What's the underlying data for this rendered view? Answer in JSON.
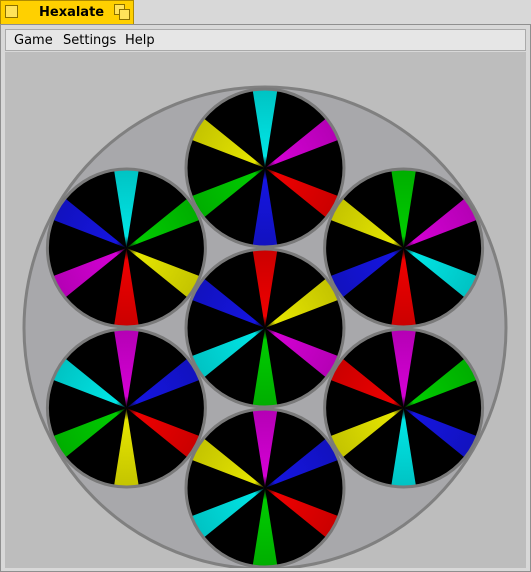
{
  "window": {
    "title": "Hexalate"
  },
  "menu": {
    "items": [
      {
        "label": "Game"
      },
      {
        "label": "Settings"
      },
      {
        "label": "Help"
      }
    ]
  },
  "board": {
    "outer_color": "#a8a8ab",
    "outer_border_color": "#808080",
    "piece_border_color": "#7a7a7a",
    "palette": {
      "cyan": "#00e5e5",
      "magenta": "#d400d4",
      "red": "#ee0000",
      "blue": "#1515e0",
      "green": "#00cc00",
      "yellow": "#e6e600"
    },
    "pieces": [
      {
        "id": "top",
        "colors": [
          "cyan",
          "magenta",
          "red",
          "blue",
          "green",
          "yellow"
        ]
      },
      {
        "id": "upper-left",
        "colors": [
          "cyan",
          "green",
          "yellow",
          "red",
          "magenta",
          "blue"
        ]
      },
      {
        "id": "upper-right",
        "colors": [
          "green",
          "magenta",
          "cyan",
          "red",
          "blue",
          "yellow"
        ]
      },
      {
        "id": "center",
        "colors": [
          "red",
          "yellow",
          "magenta",
          "green",
          "cyan",
          "blue"
        ]
      },
      {
        "id": "lower-left",
        "colors": [
          "magenta",
          "blue",
          "red",
          "yellow",
          "green",
          "cyan"
        ]
      },
      {
        "id": "lower-right",
        "colors": [
          "magenta",
          "green",
          "blue",
          "cyan",
          "yellow",
          "red"
        ]
      },
      {
        "id": "bottom",
        "colors": [
          "magenta",
          "blue",
          "red",
          "green",
          "cyan",
          "yellow"
        ]
      }
    ]
  }
}
